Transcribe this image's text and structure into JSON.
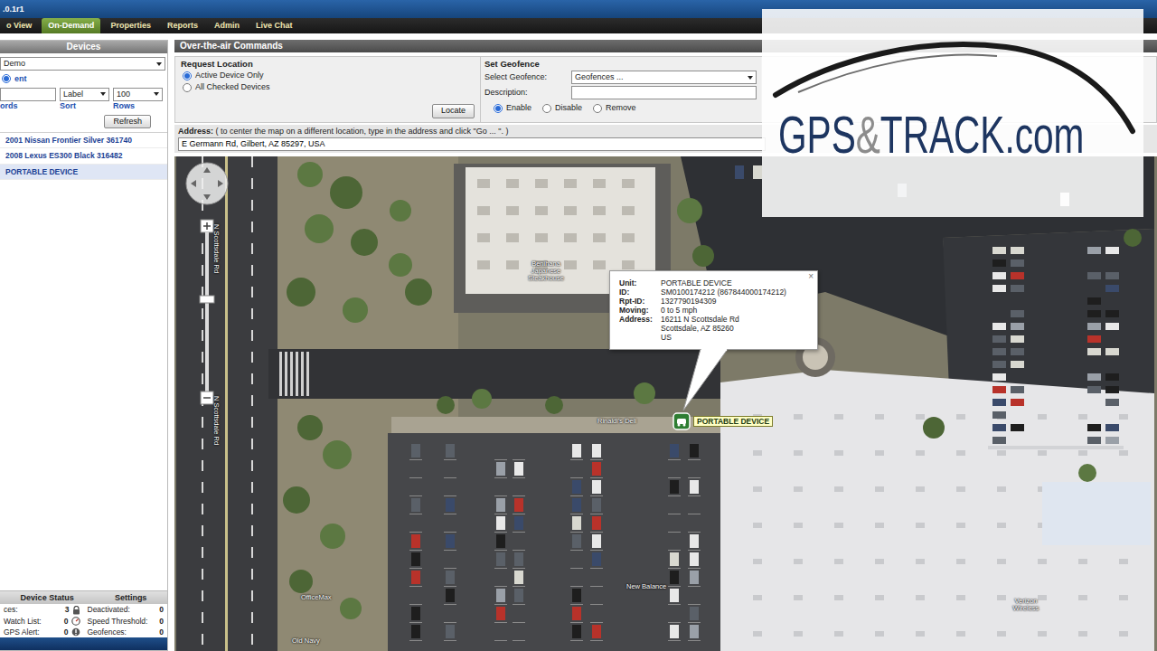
{
  "app": {
    "version": ".0.1r1"
  },
  "tabs": [
    {
      "label": "o View",
      "selected": false
    },
    {
      "label": "On-Demand",
      "selected": true
    },
    {
      "label": "Properties",
      "selected": false
    },
    {
      "label": "Reports",
      "selected": false
    },
    {
      "label": "Admin",
      "selected": false
    },
    {
      "label": "Live Chat",
      "selected": false
    }
  ],
  "devices": {
    "title": "Devices",
    "account": "Demo",
    "filter": {
      "label": "ent",
      "selected": true
    },
    "sort": "Label",
    "rows": "100",
    "field_labels": [
      "ords",
      "Sort",
      "Rows"
    ],
    "refresh": "Refresh",
    "items": [
      {
        "label": "2001 Nissan Frontier Silver 361740",
        "selected": false
      },
      {
        "label": "2008 Lexus ES300 Black 316482",
        "selected": false
      },
      {
        "label": "PORTABLE DEVICE",
        "selected": true
      }
    ]
  },
  "status": {
    "headers": [
      "Device Status",
      "Settings"
    ],
    "rows": [
      [
        {
          "label": "ces:",
          "value": "3"
        },
        {
          "label": "Deactivated:",
          "value": "0"
        }
      ],
      [
        {
          "label": "Watch List:",
          "value": "0"
        },
        {
          "label": "Speed Threshold:",
          "value": "0"
        }
      ],
      [
        {
          "label": "GPS Alert:",
          "value": "0"
        },
        {
          "label": "Geofences:",
          "value": "0"
        }
      ]
    ]
  },
  "commands": {
    "title": "Over-the-air Commands",
    "request": {
      "title": "Request Location",
      "options": [
        {
          "label": "Active Device Only",
          "selected": true
        },
        {
          "label": "All Checked Devices",
          "selected": false
        }
      ],
      "button": "Locate"
    },
    "geofence": {
      "title": "Set Geofence",
      "select_label": "Select Geofence:",
      "select_value": "Geofences ...",
      "description_label": "Description:",
      "options": [
        {
          "label": "Enable",
          "selected": true
        },
        {
          "label": "Disable",
          "selected": false
        },
        {
          "label": "Remove",
          "selected": false
        }
      ]
    }
  },
  "address": {
    "label": "Address:",
    "hint": "( to center the map on a different location, type in the address and click \"Go ... \". )",
    "value": "E Germann Rd, Gilbert, AZ 85297, USA"
  },
  "map": {
    "labels": [
      {
        "text": "N Scottsdale Rd"
      },
      {
        "text": "N Scottsdale Rd"
      },
      {
        "text": "Benihana Japanese Steakhouse"
      },
      {
        "text": "Rinaldi's Deli"
      },
      {
        "text": "OfficeMax"
      },
      {
        "text": "New Balance"
      },
      {
        "text": "Old Navy"
      },
      {
        "text": "Verizon Wireless"
      }
    ],
    "marker": {
      "label": "PORTABLE DEVICE"
    },
    "popup": {
      "close": "×",
      "fields": [
        {
          "key": "Unit:",
          "lines": [
            "PORTABLE DEVICE"
          ]
        },
        {
          "key": "ID:",
          "lines": [
            "SM0100174212 (867844000174212)"
          ]
        },
        {
          "key": "Rpt-ID:",
          "lines": [
            "1327790194309"
          ]
        },
        {
          "key": "Moving:",
          "lines": [
            "0 to 5 mph"
          ]
        },
        {
          "key": "Address:",
          "lines": [
            "16211 N Scottsdale Rd",
            "Scottsdale, AZ 85260",
            "US"
          ]
        }
      ]
    }
  },
  "watermark": {
    "parts": [
      "GPS",
      "&",
      "TRACK.com"
    ]
  }
}
